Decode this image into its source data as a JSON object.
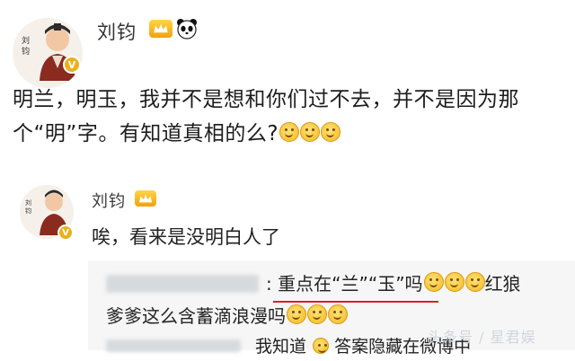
{
  "post": {
    "username": "刘钧",
    "text": "明兰，明玉，我并不是想和你们过不去，并不是因为那个“明”字。有知道真相的么?",
    "line1": "明兰，明玉，我并不是想和你们过不去，并不是因为那",
    "line2": "个“明”字。有知道真相的么?"
  },
  "comment": {
    "username": "刘钧",
    "text": "唉，看来是没明白人了"
  },
  "quoted_reply": {
    "prefix": ":",
    "line1": "重点在“兰”“玉”吗",
    "line1_tail": "红狼",
    "line2": "爹爹这么含蓄滴浪漫吗"
  },
  "second_reply": {
    "text_visible": "我知道",
    "text_tail": "答案隐藏在微博中"
  },
  "watermark": "头条号 / 星君娱",
  "icons": {
    "crown": "vip-crown-icon",
    "panda": "panda-icon",
    "smile": "smile-emoji-icon",
    "verified": "verified-badge-icon"
  }
}
